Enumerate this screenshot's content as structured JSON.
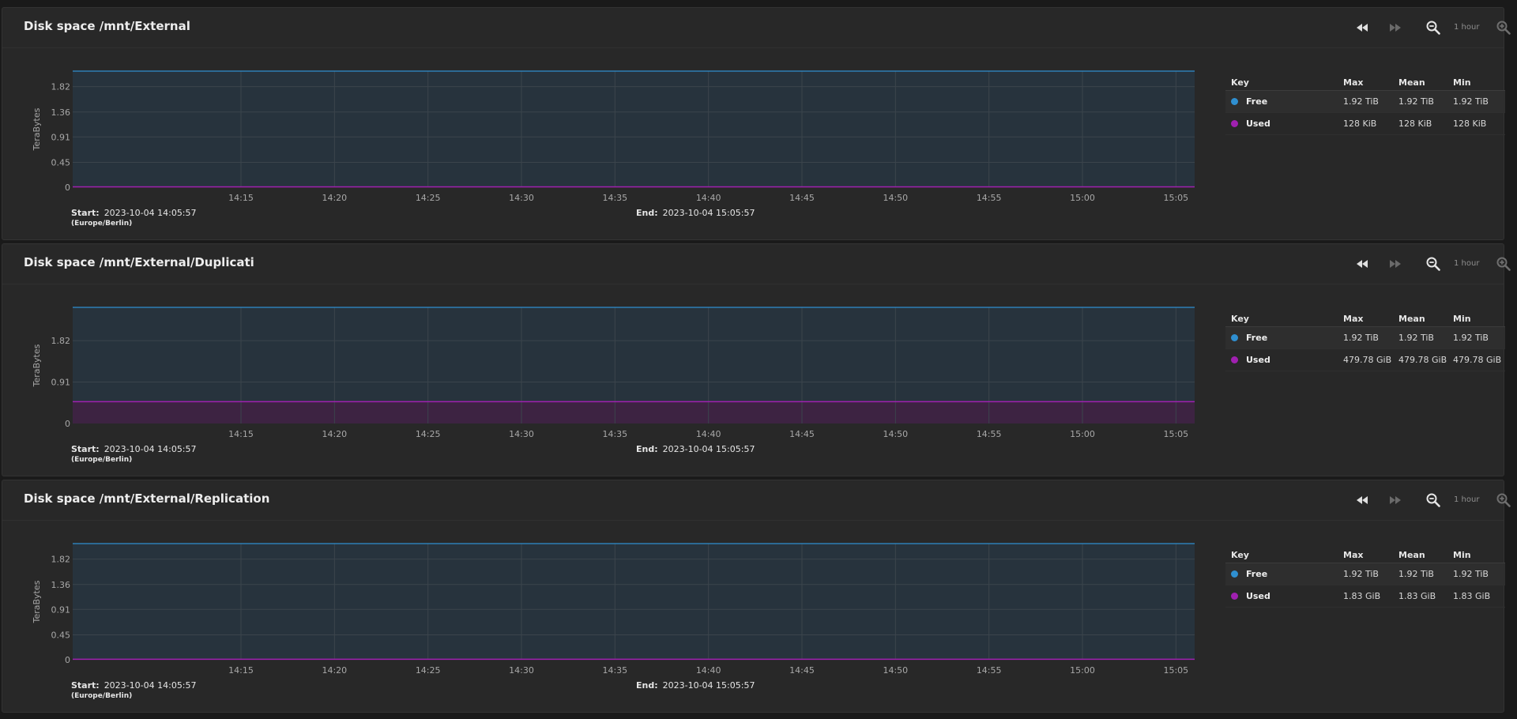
{
  "colors": {
    "free": "#2f8fd0",
    "used": "#a020b0",
    "free_fill": "#27333d",
    "used_fill": "#3d2342"
  },
  "toolbar": {
    "range_label": "1 hour"
  },
  "panels": [
    {
      "title": "Disk space /mnt/External",
      "start_label": "Start:",
      "start_value": "2023-10-04 14:05:57",
      "timezone": "(Europe/Berlin)",
      "end_label": "End:",
      "end_value": "2023-10-04 15:05:57",
      "legend": {
        "headers": {
          "key": "Key",
          "max": "Max",
          "mean": "Mean",
          "min": "Min"
        },
        "rows": [
          {
            "name": "Free",
            "max": "1.92 TiB",
            "mean": "1.92 TiB",
            "min": "1.92 TiB"
          },
          {
            "name": "Used",
            "max": "128 KiB",
            "mean": "128 KiB",
            "min": "128 KiB"
          }
        ]
      }
    },
    {
      "title": "Disk space /mnt/External/Duplicati",
      "start_label": "Start:",
      "start_value": "2023-10-04 14:05:57",
      "timezone": "(Europe/Berlin)",
      "end_label": "End:",
      "end_value": "2023-10-04 15:05:57",
      "legend": {
        "headers": {
          "key": "Key",
          "max": "Max",
          "mean": "Mean",
          "min": "Min"
        },
        "rows": [
          {
            "name": "Free",
            "max": "1.92 TiB",
            "mean": "1.92 TiB",
            "min": "1.92 TiB"
          },
          {
            "name": "Used",
            "max": "479.78 GiB",
            "mean": "479.78 GiB",
            "min": "479.78 GiB"
          }
        ]
      }
    },
    {
      "title": "Disk space /mnt/External/Replication",
      "start_label": "Start:",
      "start_value": "2023-10-04 14:05:57",
      "timezone": "(Europe/Berlin)",
      "end_label": "End:",
      "end_value": "2023-10-04 15:05:57",
      "legend": {
        "headers": {
          "key": "Key",
          "max": "Max",
          "mean": "Mean",
          "min": "Min"
        },
        "rows": [
          {
            "name": "Free",
            "max": "1.92 TiB",
            "mean": "1.92 TiB",
            "min": "1.92 TiB"
          },
          {
            "name": "Used",
            "max": "1.83 GiB",
            "mean": "1.83 GiB",
            "min": "1.83 GiB"
          }
        ]
      }
    }
  ],
  "chart_data": [
    {
      "type": "area",
      "stacked": true,
      "ylabel": "TeraBytes",
      "xlim": [
        "14:06",
        "15:06"
      ],
      "ylim": [
        0,
        2.1
      ],
      "yticks": [
        "0",
        "0.45",
        "0.91",
        "1.36",
        "1.82"
      ],
      "ytick_values": [
        0,
        0.45,
        0.91,
        1.36,
        1.82
      ],
      "xticks": [
        "14:15",
        "14:20",
        "14:25",
        "14:30",
        "14:35",
        "14:40",
        "14:45",
        "14:50",
        "14:55",
        "15:00",
        "15:05"
      ],
      "grid": true,
      "series": [
        {
          "name": "Used",
          "color": "#a020b0",
          "x": [
            "14:06",
            "15:06"
          ],
          "y": [
            1e-07,
            1e-07
          ]
        },
        {
          "name": "Free",
          "color": "#2f8fd0",
          "x": [
            "14:06",
            "15:06"
          ],
          "y": [
            2.11,
            2.11
          ]
        }
      ]
    },
    {
      "type": "area",
      "stacked": true,
      "ylabel": "TeraBytes",
      "xlim": [
        "14:06",
        "15:06"
      ],
      "ylim": [
        0,
        2.55
      ],
      "yticks": [
        "0",
        "0.91",
        "1.82"
      ],
      "ytick_values": [
        0,
        0.91,
        1.82
      ],
      "xticks": [
        "14:15",
        "14:20",
        "14:25",
        "14:30",
        "14:35",
        "14:40",
        "14:45",
        "14:50",
        "14:55",
        "15:00",
        "15:05"
      ],
      "grid": true,
      "series": [
        {
          "name": "Used",
          "color": "#a020b0",
          "x": [
            "14:06",
            "15:06"
          ],
          "y": [
            0.47,
            0.47
          ]
        },
        {
          "name": "Free",
          "color": "#2f8fd0",
          "x": [
            "14:06",
            "15:06"
          ],
          "y": [
            2.11,
            2.11
          ]
        }
      ]
    },
    {
      "type": "area",
      "stacked": true,
      "ylabel": "TeraBytes",
      "xlim": [
        "14:06",
        "15:06"
      ],
      "ylim": [
        0,
        2.1
      ],
      "yticks": [
        "0",
        "0.45",
        "0.91",
        "1.36",
        "1.82"
      ],
      "ytick_values": [
        0,
        0.45,
        0.91,
        1.36,
        1.82
      ],
      "xticks": [
        "14:15",
        "14:20",
        "14:25",
        "14:30",
        "14:35",
        "14:40",
        "14:45",
        "14:50",
        "14:55",
        "15:00",
        "15:05"
      ],
      "grid": true,
      "series": [
        {
          "name": "Used",
          "color": "#a020b0",
          "x": [
            "14:06",
            "15:06"
          ],
          "y": [
            0.0018,
            0.0018
          ]
        },
        {
          "name": "Free",
          "color": "#2f8fd0",
          "x": [
            "14:06",
            "15:06"
          ],
          "y": [
            2.11,
            2.11
          ]
        }
      ]
    }
  ]
}
